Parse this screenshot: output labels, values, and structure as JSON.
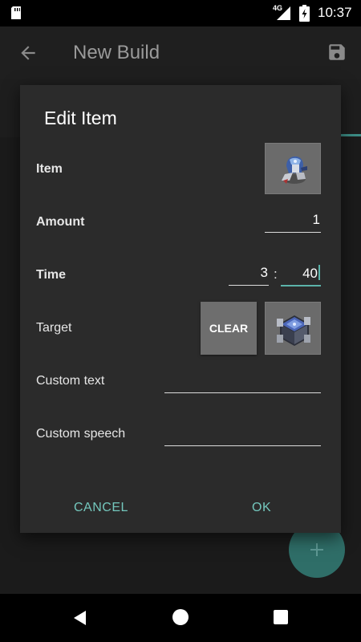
{
  "status_bar": {
    "network": "4G",
    "time": "10:37"
  },
  "app_bar": {
    "title": "New Build"
  },
  "dialog": {
    "title": "Edit Item",
    "rows": {
      "item_label": "Item",
      "amount_label": "Amount",
      "amount_value": "1",
      "time_label": "Time",
      "time_minutes": "3",
      "time_separator": ":",
      "time_seconds": "40",
      "target_label": "Target",
      "clear_label": "CLEAR",
      "custom_text_label": "Custom text",
      "custom_text_value": "",
      "custom_speech_label": "Custom speech",
      "custom_speech_value": ""
    },
    "actions": {
      "cancel": "CANCEL",
      "ok": "OK"
    }
  },
  "icons": {
    "status": [
      "sd-card-icon",
      "signal-icon",
      "battery-charging-icon"
    ],
    "app_bar": [
      "back-arrow-icon",
      "save-icon"
    ],
    "fab": "plus-icon",
    "nav": [
      "nav-back-icon",
      "nav-home-icon",
      "nav-recents-icon"
    ]
  },
  "colors": {
    "accent": "#74c7bd",
    "dialog_bg": "#2b2b2b",
    "tile_bg": "#6b6b6b",
    "fab": "#2f6e68"
  }
}
